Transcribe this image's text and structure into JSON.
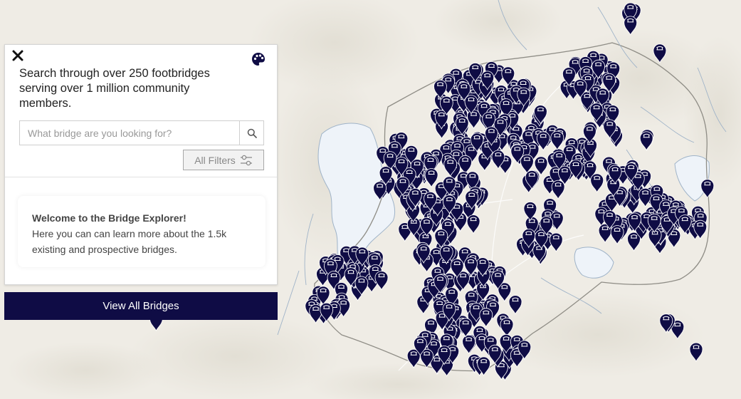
{
  "panel": {
    "intro_text": "Search through over 250 footbridges serving over 1 million community members.",
    "search_placeholder": "What bridge are you looking for?",
    "filters_label": "All Filters",
    "welcome_title": "Welcome to the Bridge Explorer!",
    "welcome_body": "Here you can can learn more about the 1.5k existing and prospective bridges.",
    "view_all_label": "View All Bridges"
  },
  "icons": {
    "close": "close-icon",
    "palette": "palette-icon",
    "search": "search-icon",
    "filters": "sliders-icon",
    "marker": "bridge-marker-icon"
  },
  "colors": {
    "marker": "#0f0c45",
    "button": "#0f0c45",
    "land": "#efece5",
    "water": "#eef3f9"
  }
}
